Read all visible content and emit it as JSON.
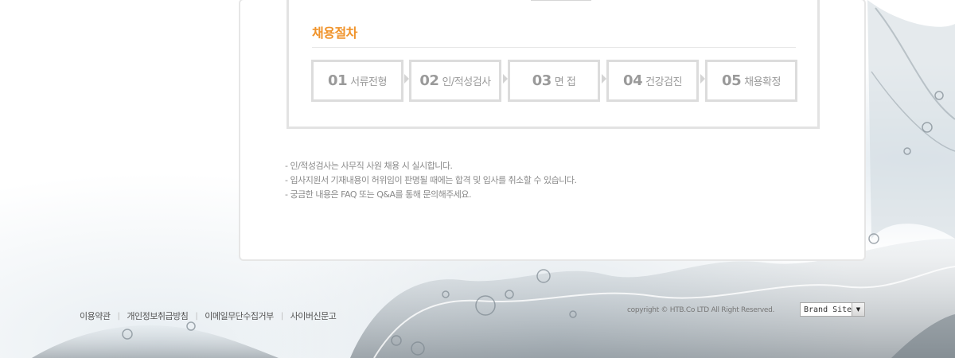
{
  "recruit": {
    "title": "채용절차",
    "steps": [
      {
        "num": "01",
        "label": "서류전형"
      },
      {
        "num": "02",
        "label": "인/적성검사"
      },
      {
        "num": "03",
        "label": "면 접"
      },
      {
        "num": "04",
        "label": "건강검진"
      },
      {
        "num": "05",
        "label": "채용확정"
      }
    ]
  },
  "notes": [
    "- 인/적성검사는 사무직 사원 채용 시 실시합니다.",
    "- 입사지원서 기재내용이 허위임이 판명될 때에는 합격 및 입사를 취소할 수 있습니다.",
    "- 궁금한 내용은 FAQ 또는 Q&A를 통해  문의해주세요."
  ],
  "footer": {
    "links": [
      "이용약관",
      "개인정보취급방침",
      "이메일무단수집거부",
      "사이버신문고"
    ],
    "copyright": "copyright © HTB.Co LTD All Right Reserved.",
    "brand_select": "Brand Site"
  },
  "colors": {
    "accent": "#f0932a",
    "step_text": "#9a9a9a",
    "step_border": "#dcdcdc"
  }
}
